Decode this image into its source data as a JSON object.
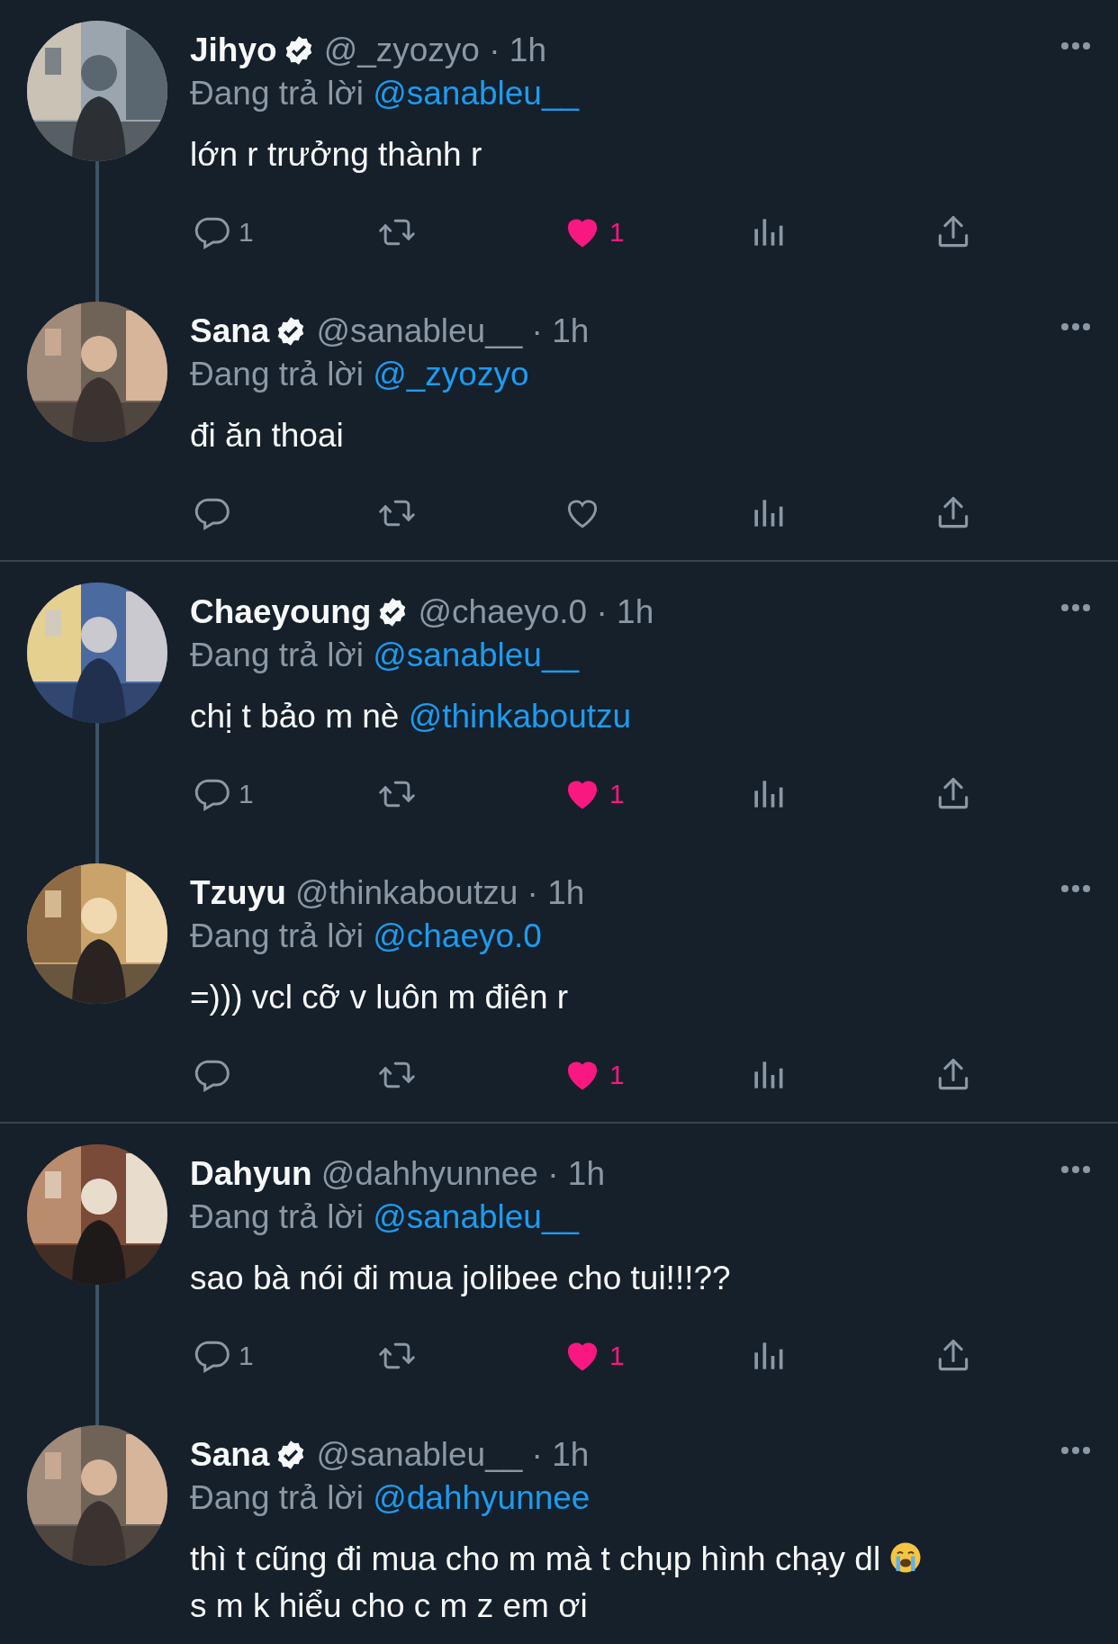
{
  "tweets": [
    {
      "name": "Jihyo",
      "verified": true,
      "meta": "@_zyozyo · 1h",
      "replying_label": "Đang trả lời",
      "reply_to": "@sanableu__",
      "text_parts": [
        {
          "kind": "text",
          "text": "lớn r trưởng thành r"
        }
      ],
      "reply_count": "1",
      "liked": true,
      "like_count": "1",
      "thread_below": true,
      "divider_below": false,
      "show_actions": true
    },
    {
      "name": "Sana",
      "verified": true,
      "meta": "@sanableu__ · 1h",
      "replying_label": "Đang trả lời",
      "reply_to": "@_zyozyo",
      "text_parts": [
        {
          "kind": "text",
          "text": "đi ăn thoai"
        }
      ],
      "liked": false,
      "thread_below": false,
      "divider_below": true,
      "show_actions": true
    },
    {
      "name": "Chaeyoung",
      "verified": true,
      "meta": "@chaeyo.0 · 1h",
      "replying_label": "Đang trả lời",
      "reply_to": "@sanableu__",
      "text_parts": [
        {
          "kind": "text",
          "text": "chị t bảo m nè "
        },
        {
          "kind": "mention",
          "text": "@thinkaboutzu"
        }
      ],
      "reply_count": "1",
      "liked": true,
      "like_count": "1",
      "thread_below": true,
      "divider_below": false,
      "show_actions": true
    },
    {
      "name": "Tzuyu",
      "verified": false,
      "meta": "@thinkaboutzu · 1h",
      "replying_label": "Đang trả lời",
      "reply_to": "@chaeyo.0",
      "text_parts": [
        {
          "kind": "text",
          "text": "=))) vcl cỡ v luôn m điên r"
        }
      ],
      "liked": true,
      "like_count": "1",
      "thread_below": false,
      "divider_below": true,
      "show_actions": true
    },
    {
      "name": "Dahyun",
      "verified": false,
      "meta": "@dahhyunnee · 1h",
      "replying_label": "Đang trả lời",
      "reply_to": "@sanableu__",
      "text_parts": [
        {
          "kind": "text",
          "text": "sao bà nói đi mua jolibee cho tui!!!??"
        }
      ],
      "reply_count": "1",
      "liked": true,
      "like_count": "1",
      "thread_below": true,
      "divider_below": false,
      "show_actions": true
    },
    {
      "name": "Sana",
      "verified": true,
      "meta": "@sanableu__ · 1h",
      "replying_label": "Đang trả lời",
      "reply_to": "@dahhyunnee",
      "text_parts": [
        {
          "kind": "text",
          "text": "thì t cũng đi mua cho m mà t chụp hình chạy dl"
        },
        {
          "kind": "emoji"
        },
        {
          "kind": "text",
          "text": "s m k hiểu cho c m z em ơi",
          "new_line": true
        }
      ],
      "thread_below": false,
      "divider_below": false,
      "show_actions": false
    }
  ]
}
